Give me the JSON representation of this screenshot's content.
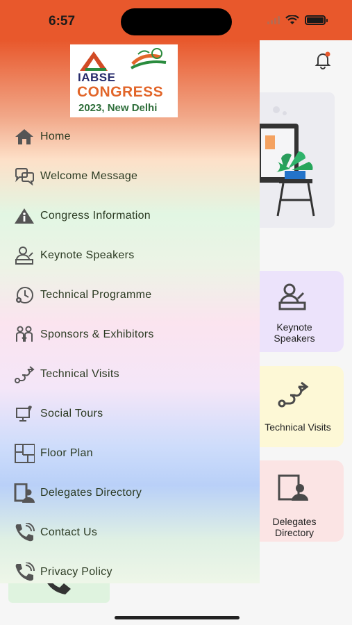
{
  "status_bar": {
    "time": "6:57"
  },
  "logo": {
    "line1": "IABSE",
    "line2": "CONGRESS",
    "line3": "2023, New Delhi"
  },
  "menu": {
    "items": [
      {
        "label": "Home",
        "icon": "home-icon"
      },
      {
        "label": "Welcome Message",
        "icon": "chat-bubbles-icon"
      },
      {
        "label": "Congress Information",
        "icon": "info-icon"
      },
      {
        "label": "Keynote Speakers",
        "icon": "speaker-icon"
      },
      {
        "label": "Technical Programme",
        "icon": "clock-gear-icon"
      },
      {
        "label": "Sponsors & Exhibitors",
        "icon": "people-icon"
      },
      {
        "label": "Technical Visits",
        "icon": "route-icon"
      },
      {
        "label": "Social Tours",
        "icon": "monitor-pin-icon"
      },
      {
        "label": "Floor Plan",
        "icon": "floor-plan-icon"
      },
      {
        "label": "Delegates Directory",
        "icon": "directory-icon"
      },
      {
        "label": "Contact Us",
        "icon": "phone-icon"
      },
      {
        "label": "Privacy Policy",
        "icon": "phone-shield-icon"
      }
    ]
  },
  "tiles": {
    "keynote": "Keynote Speakers",
    "visits": "Technical Visits",
    "delegates": "Delegates Directory"
  },
  "colors": {
    "accent": "#e8582c",
    "menu_text": "#2b3a22"
  }
}
